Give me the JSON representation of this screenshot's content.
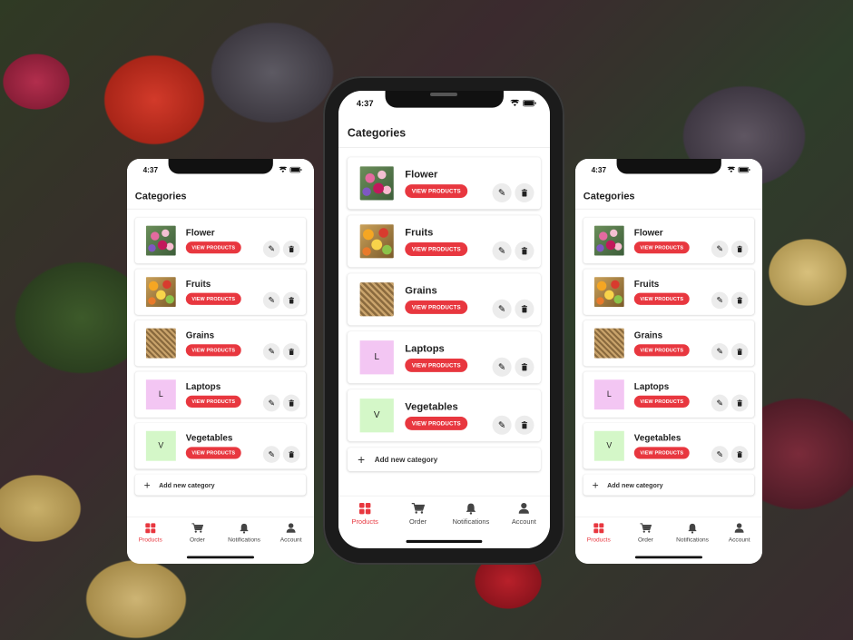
{
  "status": {
    "time": "4:37"
  },
  "header": {
    "title": "Categories"
  },
  "categories": [
    {
      "name": "Flower",
      "thumb": "photo-flower",
      "button": "VIEW PRODUCTS"
    },
    {
      "name": "Fruits",
      "thumb": "photo-fruits",
      "button": "VIEW PRODUCTS"
    },
    {
      "name": "Grains",
      "thumb": "photo-grains",
      "button": "VIEW PRODUCTS"
    },
    {
      "name": "Laptops",
      "letter": "L",
      "color": "#f3c6f3",
      "button": "VIEW PRODUCTS"
    },
    {
      "name": "Vegetables",
      "letter": "V",
      "color": "#d4f7c8",
      "button": "VIEW PRODUCTS"
    }
  ],
  "add_category": {
    "label": "Add new category"
  },
  "tabs": [
    {
      "label": "Products",
      "icon": "grid-icon",
      "active": true
    },
    {
      "label": "Order",
      "icon": "cart-icon",
      "active": false
    },
    {
      "label": "Notifications",
      "icon": "bell-icon",
      "active": false
    },
    {
      "label": "Account",
      "icon": "person-icon",
      "active": false
    }
  ],
  "colors": {
    "accent": "#e8373f",
    "card_shadow": "#d0d0d0"
  }
}
